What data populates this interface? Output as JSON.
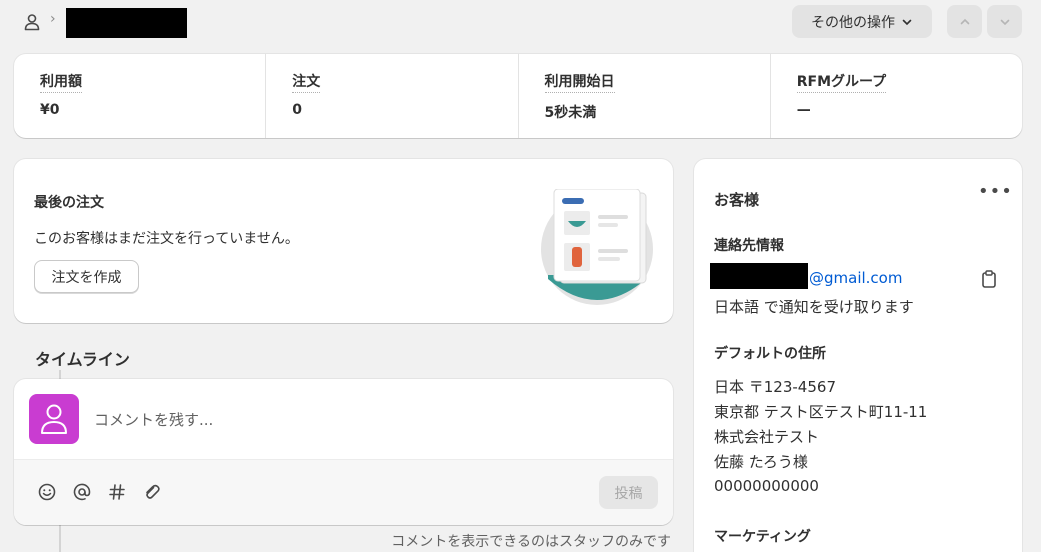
{
  "header": {
    "breadcrumb_separator": "›",
    "more_actions_label": "その他の操作"
  },
  "stats": [
    {
      "label": "利用額",
      "value": "¥0"
    },
    {
      "label": "注文",
      "value": "0"
    },
    {
      "label": "利用開始日",
      "value": "5秒未満"
    },
    {
      "label": "RFMグループ",
      "value": "—"
    }
  ],
  "last_order": {
    "title": "最後の注文",
    "description": "このお客様はまだ注文を行っていません。",
    "create_order_label": "注文を作成"
  },
  "timeline": {
    "title": "タイムライン",
    "comment_placeholder": "コメントを残す...",
    "post_label": "投稿",
    "staff_note": "コメントを表示できるのはスタッフのみです"
  },
  "customer": {
    "title": "お客様",
    "more_label": "•••",
    "contact_heading": "連絡先情報",
    "email_domain": "@gmail.com",
    "notification_language": "日本語 で通知を受け取ります",
    "address_heading": "デフォルトの住所",
    "address_lines": [
      "日本 〒123-4567",
      "東京都 テスト区テスト町11-11",
      "株式会社テスト",
      "佐藤 たろう様",
      "00000000000"
    ],
    "marketing_heading": "マーケティング"
  },
  "colors": {
    "avatar_bg": "#c93cd1",
    "link": "#005bd3",
    "illustration_teal": "#3a9a94"
  }
}
